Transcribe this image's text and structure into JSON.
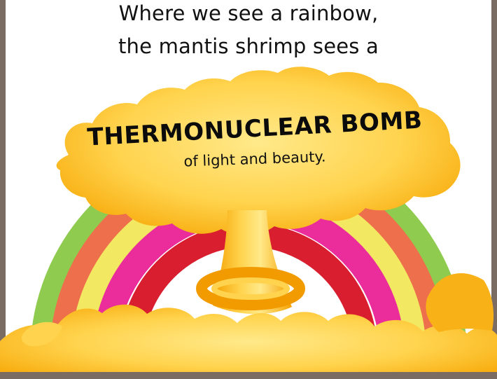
{
  "caption": {
    "line_1": "Where we see a rainbow,",
    "line_2": "the mantis shrimp sees a"
  },
  "highlight": {
    "main_text": "THERMONUCLEAR BOMB",
    "sub_text": "of light and beauty."
  },
  "colors": {
    "frame": "#7a6b63",
    "green": "#8fcb4f",
    "orange_band": "#ee6f4b",
    "yellow_band": "#f2e861",
    "pink_band": "#ea2d9b",
    "red_band": "#d91f2f",
    "blast_orange": "#f6a400",
    "blast_yellow": "#ffd34d",
    "blast_light": "#ffe98a",
    "text_dark": "#111111"
  },
  "icons": {
    "rainbow": "rainbow-icon",
    "mushroom_cloud": "mushroom-cloud-icon"
  }
}
